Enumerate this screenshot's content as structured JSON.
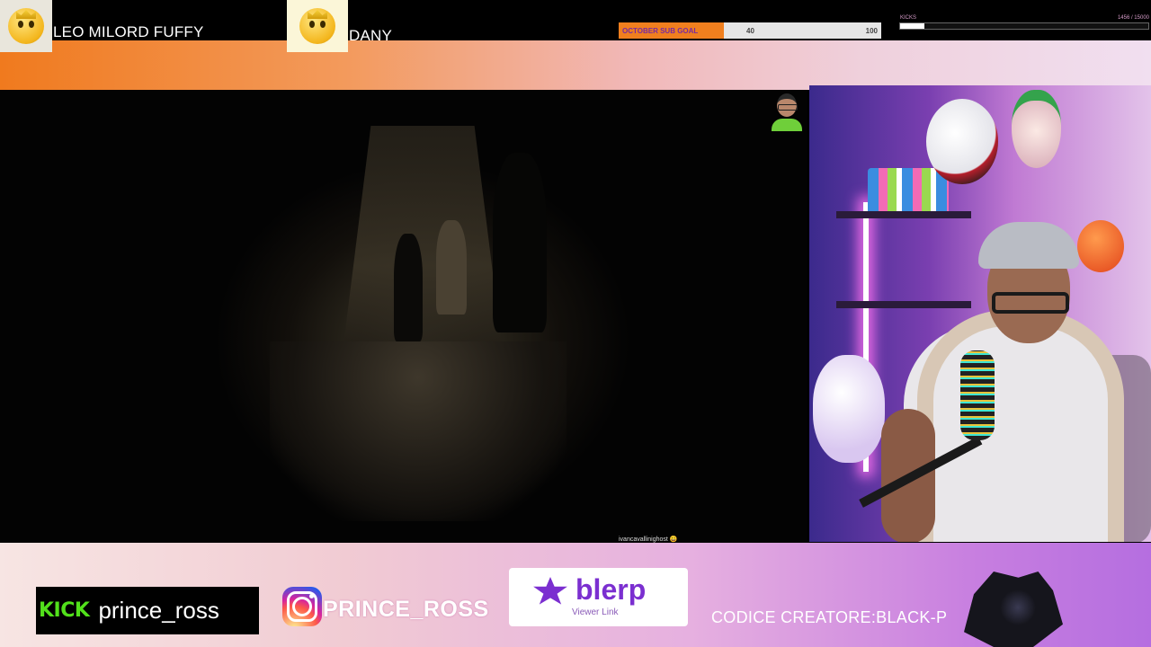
{
  "top": {
    "user1": {
      "name": "LEO MILORD FUFFY",
      "icon": "crowned-emoji-icon"
    },
    "user2": {
      "name": "DANY",
      "icon": "crowned-emoji-icon"
    }
  },
  "sub_goal": {
    "label": "OCTOBER SUB GOAL",
    "current": "40",
    "target": "100",
    "progress": 0.4,
    "fill_color": "#f07f1e"
  },
  "kicks": {
    "label": "KICKS",
    "value": "1456 / 15000",
    "progress": 0.097
  },
  "game": {
    "caption_user": "ivancavallinighost",
    "caption_emoji": "😀"
  },
  "bottom": {
    "kick_logo": "KICK",
    "kick_user": "prince_ross",
    "instagram_user": "PRINCE_ROSS",
    "blerp_word": "blerp",
    "blerp_sub": "Viewer Link",
    "creator_code": "CODICE CREATORE:BLACK-P"
  },
  "colors": {
    "kick_green": "#52e01b",
    "blerp_purple": "#7b2fd0",
    "accent_orange": "#f07a1e"
  }
}
